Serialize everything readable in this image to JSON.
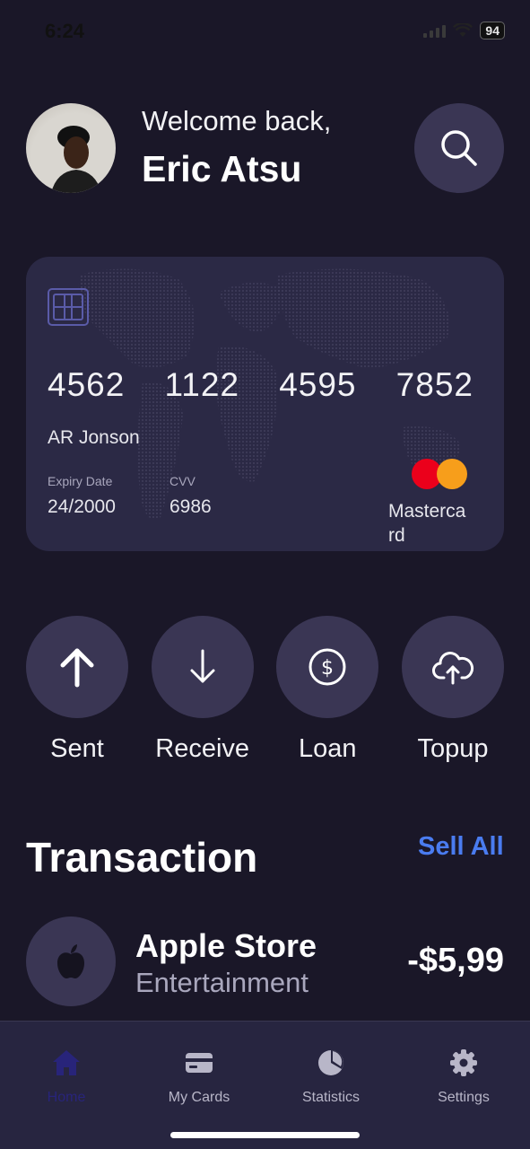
{
  "status_bar": {
    "time": "6:24",
    "battery": "94"
  },
  "header": {
    "welcome": "Welcome back,",
    "user_name": "Eric Atsu"
  },
  "card": {
    "number_groups": [
      "4562",
      "1122",
      "4595",
      "7852"
    ],
    "holder": "AR Jonson",
    "expiry_label": "Expiry Date",
    "expiry_value": "24/2000",
    "cvv_label": "CVV",
    "cvv_value": "6986",
    "brand": "Mastercard"
  },
  "actions": [
    {
      "label": "Sent",
      "icon": "arrow-up-icon"
    },
    {
      "label": "Receive",
      "icon": "arrow-down-icon"
    },
    {
      "label": "Loan",
      "icon": "dollar-icon"
    },
    {
      "label": "Topup",
      "icon": "cloud-upload-icon"
    }
  ],
  "transactions": {
    "title": "Transaction",
    "see_all": "Sell All",
    "items": [
      {
        "name": "Apple Store",
        "category": "Entertainment",
        "amount": "-$5,99",
        "icon": "apple-icon"
      }
    ]
  },
  "bottom_nav": {
    "items": [
      {
        "label": "Home",
        "icon": "home-icon",
        "active": true
      },
      {
        "label": "My Cards",
        "icon": "card-icon",
        "active": false
      },
      {
        "label": "Statistics",
        "icon": "pie-chart-icon",
        "active": false
      },
      {
        "label": "Settings",
        "icon": "gear-icon",
        "active": false
      }
    ]
  },
  "colors": {
    "background": "#1a1728",
    "surface": "#3a3654",
    "card": "#2b2945",
    "accent": "#4a7cf0",
    "nav_active": "#28247a"
  }
}
